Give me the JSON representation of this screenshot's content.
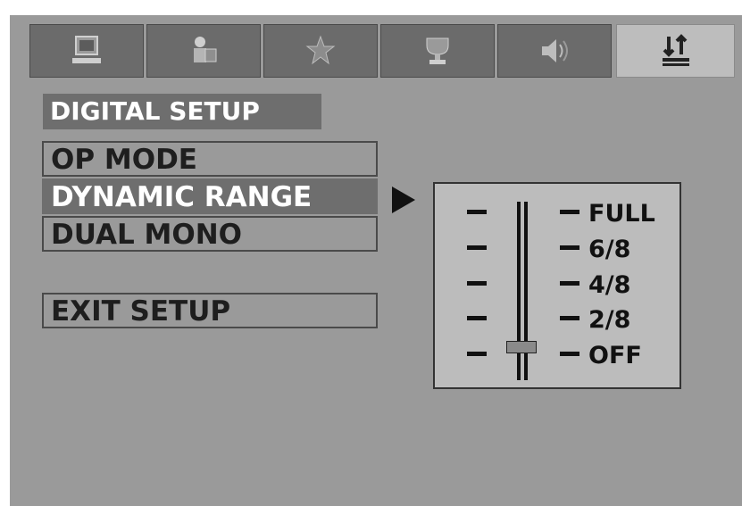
{
  "tabs": [
    {
      "icon": "monitor-icon",
      "active": false
    },
    {
      "icon": "settings-person-icon",
      "active": false
    },
    {
      "icon": "star-figure-icon",
      "active": false
    },
    {
      "icon": "trophy-icon",
      "active": false
    },
    {
      "icon": "speaker-icon",
      "active": false
    },
    {
      "icon": "digital-setup-icon",
      "active": true
    }
  ],
  "section_title": "DIGITAL SETUP",
  "menu": {
    "items": [
      "OP MODE",
      "DYNAMIC RANGE",
      "DUAL MONO"
    ],
    "selected": "DYNAMIC RANGE",
    "exit": "EXIT SETUP"
  },
  "range": {
    "levels": [
      "FULL",
      "6/8",
      "4/8",
      "2/8",
      "OFF"
    ],
    "current": "OFF"
  },
  "colors": {
    "background": "#9a9a9a",
    "highlight": "#6e6e6e",
    "panel": "#bcbcbc",
    "text": "#1e1e1e",
    "highlight_text": "#ffffff"
  }
}
